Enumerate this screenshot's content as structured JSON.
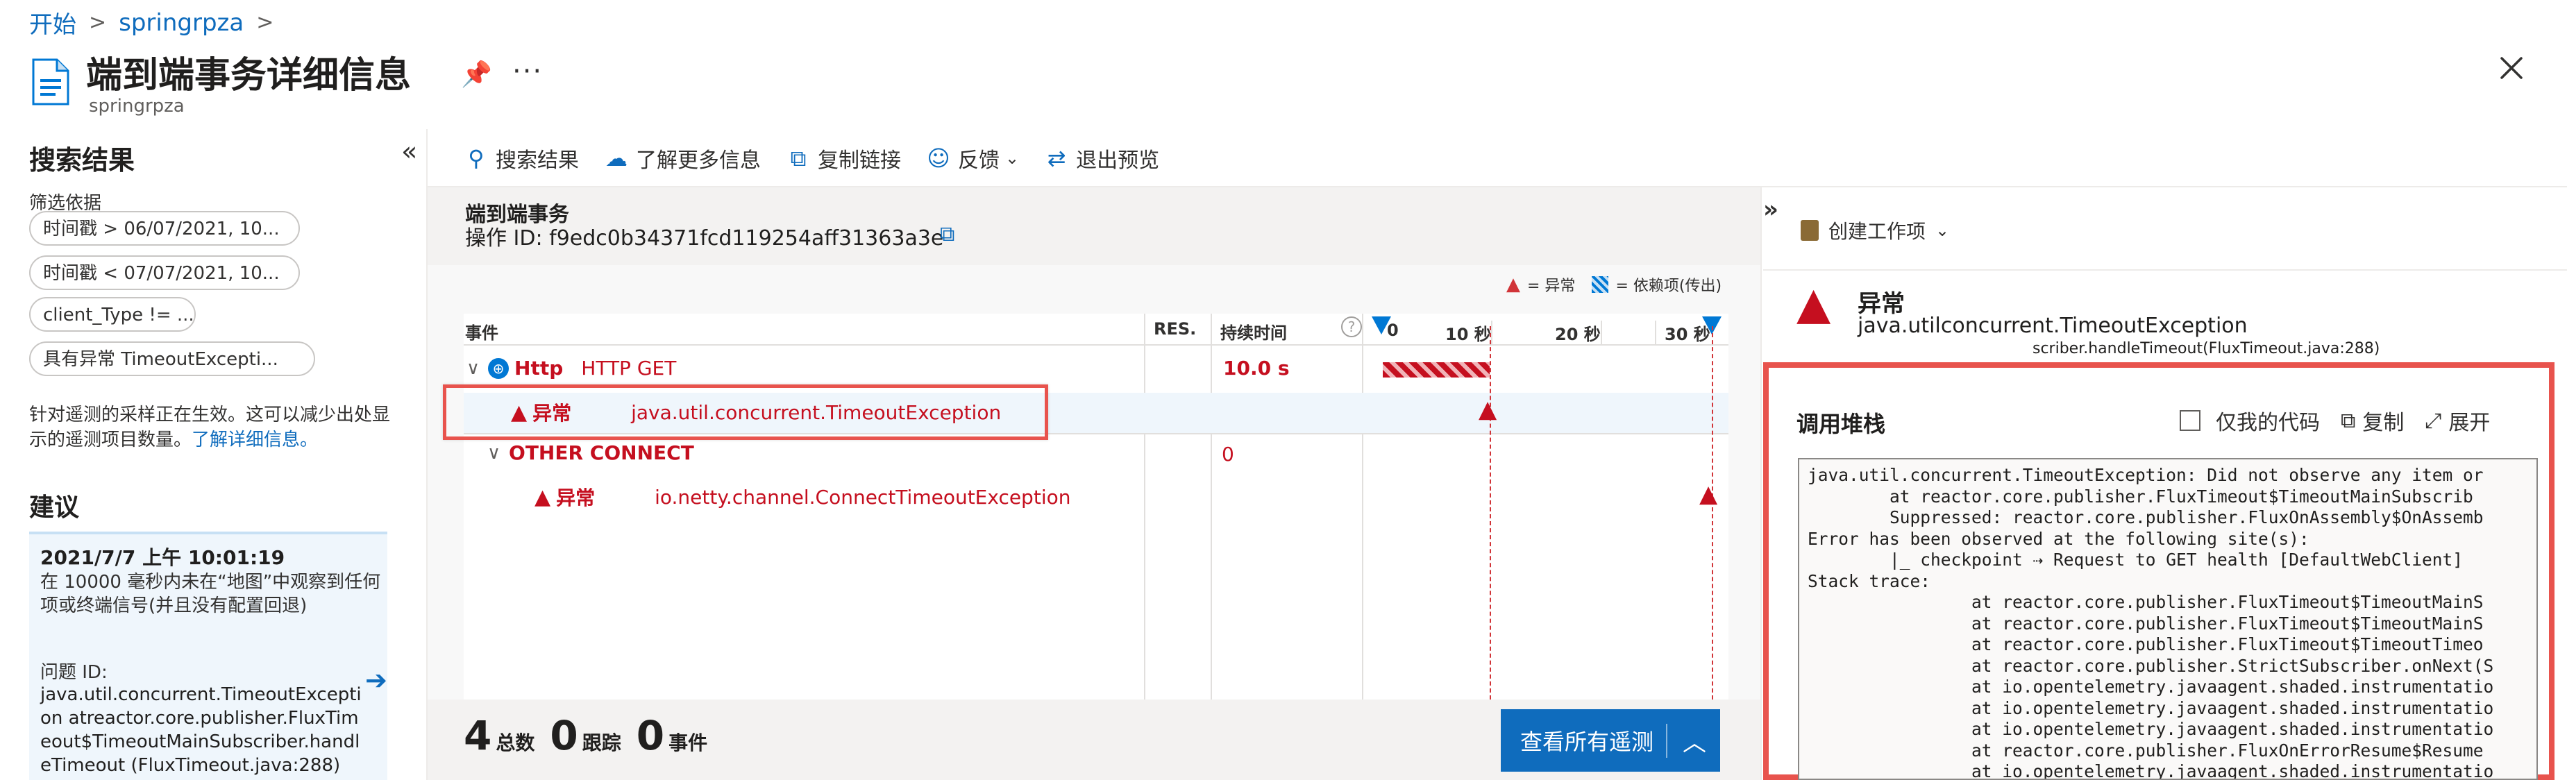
{
  "breadcrumb": {
    "home": "开始",
    "resource": "springrpza"
  },
  "header": {
    "title": "端到端事务详细信息",
    "subtitle": "springrpza"
  },
  "left": {
    "title": "搜索结果",
    "filter_label": "筛选依据",
    "filters": [
      "时间戳 > 06/07/2021, 10...",
      "时间戳 < 07/07/2021, 10...",
      "client_Type != ...",
      "具有异常 TimeoutExcepti..."
    ],
    "sampling_note": "针对遥测的采样正在生效。这可以减少出处显示的遥测项目数量。",
    "sampling_link": "了解详细信息。",
    "rec_title": "建议",
    "rec": {
      "date": "2021/7/7 上午 10:01:19",
      "desc": "在 10000 毫秒内未在“地图”中观察到任何项或终端信号(并且没有配置回退)",
      "issue_label": "问题 ID:",
      "issue": "java.util.concurrent.TimeoutException atreactor.core.publisher.FluxTimeout$TimeoutMainSubscriber.handleTimeout (FluxTimeout.java:288)"
    }
  },
  "toolbar": {
    "search": "搜索结果",
    "learn": "了解更多信息",
    "copy_link": "复制链接",
    "feedback": "反馈",
    "exit_preview": "退出预览"
  },
  "transaction": {
    "title": "端到端事务",
    "op_id": "操作 ID: f9edc0b34371fcd119254aff31363a3e",
    "legend_exception": "= 异常",
    "legend_dependency": "= 依赖项(传出)",
    "columns": {
      "event": "事件",
      "res": "RES.",
      "duration": "持续时间"
    },
    "ticks": [
      "0",
      "10 秒",
      "20 秒",
      "30 秒"
    ],
    "rows": [
      {
        "name": "Http",
        "detail": "HTTP GET",
        "duration": "10.0 s"
      },
      {
        "name": "异常",
        "detail": "java.util.concurrent.TimeoutException"
      },
      {
        "name": "OTHER CONNECT",
        "duration": "0"
      },
      {
        "name": "异常",
        "detail": "io.netty.channel.ConnectTimeoutException"
      }
    ]
  },
  "stats": {
    "total_num": "4",
    "total_label": "总数",
    "trace_num": "0",
    "trace_label": "跟踪",
    "event_num": "0",
    "event_label": "事件",
    "view_all": "查看所有遥测"
  },
  "right": {
    "create_work_item": "创建工作项",
    "exception_title": "异常",
    "exception_type": "java.utilconcurrent.TimeoutException",
    "clipped_text": "scriber.handleTimeout(FluxTimeout.java:288)",
    "stack_title": "调用堆栈",
    "my_code_only": "仅我的代码",
    "copy": "复制",
    "expand": "展开",
    "stack_trace": "java.util.concurrent.TimeoutException: Did not observe any item or\n        at reactor.core.publisher.FluxTimeout$TimeoutMainSubscrib\n        Suppressed: reactor.core.publisher.FluxOnAssembly$OnAssemb\nError has been observed at the following site(s):\n        |_ checkpoint ⇢ Request to GET health [DefaultWebClient]\nStack trace:\n                at reactor.core.publisher.FluxTimeout$TimeoutMainS\n                at reactor.core.publisher.FluxTimeout$TimeoutMainS\n                at reactor.core.publisher.FluxTimeout$TimeoutTimeo\n                at reactor.core.publisher.StrictSubscriber.onNext(S\n                at io.opentelemetry.javaagent.shaded.instrumentatio\n                at io.opentelemetry.javaagent.shaded.instrumentatio\n                at io.opentelemetry.javaagent.shaded.instrumentatio\n                at reactor.core.publisher.FluxOnErrorResume$Resume\n                at io.opentelemetry.javaagent.shaded.instrumentatio"
  },
  "colors": {
    "accent": "#0f6cbd",
    "error": "#c50f1f",
    "highlight": "#e8534d"
  }
}
